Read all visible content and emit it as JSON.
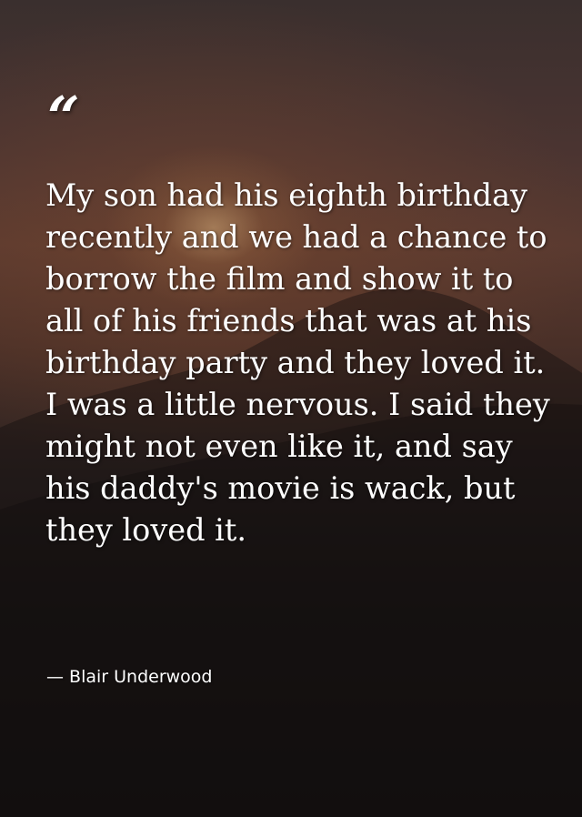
{
  "quote": {
    "mark": "“",
    "text": "My son had his eighth birthday recently and we had a chance to borrow the film and show it to all of his friends that was at his birthday party and they loved it. I was a little nervous. I said they might not even like it, and say his daddy's movie is wack, but they loved it.",
    "author": "— Blair Underwood"
  }
}
